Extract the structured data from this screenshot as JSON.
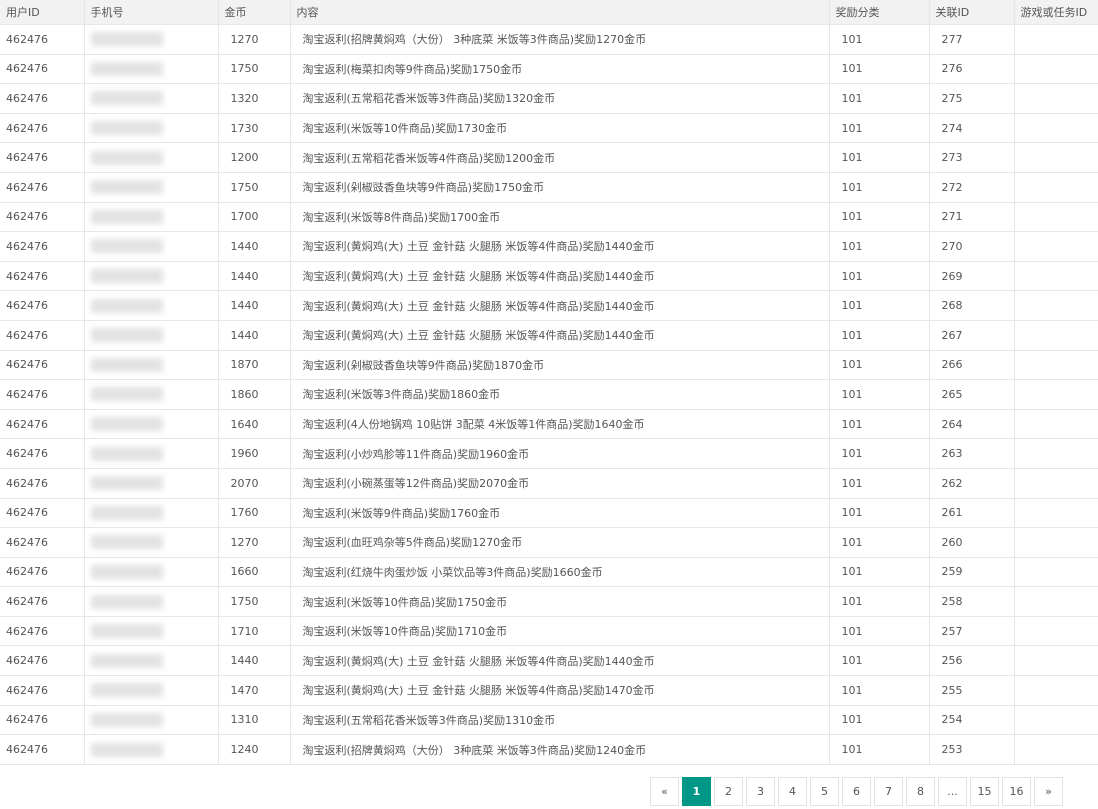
{
  "table": {
    "headers": [
      "用户ID",
      "手机号",
      "金币",
      "内容",
      "奖励分类",
      "关联ID",
      "游戏或任务ID"
    ],
    "rows": [
      {
        "uid": "462476",
        "coin": "1270",
        "content": "淘宝返利(招牌黄焖鸡（大份） 3种底菜 米饭等3件商品)奖励1270金币",
        "cat": "101",
        "rel": "277",
        "game": ""
      },
      {
        "uid": "462476",
        "coin": "1750",
        "content": "淘宝返利(梅菜扣肉等9件商品)奖励1750金币",
        "cat": "101",
        "rel": "276",
        "game": ""
      },
      {
        "uid": "462476",
        "coin": "1320",
        "content": "淘宝返利(五常稻花香米饭等3件商品)奖励1320金币",
        "cat": "101",
        "rel": "275",
        "game": ""
      },
      {
        "uid": "462476",
        "coin": "1730",
        "content": "淘宝返利(米饭等10件商品)奖励1730金币",
        "cat": "101",
        "rel": "274",
        "game": ""
      },
      {
        "uid": "462476",
        "coin": "1200",
        "content": "淘宝返利(五常稻花香米饭等4件商品)奖励1200金币",
        "cat": "101",
        "rel": "273",
        "game": ""
      },
      {
        "uid": "462476",
        "coin": "1750",
        "content": "淘宝返利(剁椒豉香鱼块等9件商品)奖励1750金币",
        "cat": "101",
        "rel": "272",
        "game": ""
      },
      {
        "uid": "462476",
        "coin": "1700",
        "content": "淘宝返利(米饭等8件商品)奖励1700金币",
        "cat": "101",
        "rel": "271",
        "game": ""
      },
      {
        "uid": "462476",
        "coin": "1440",
        "content": "淘宝返利(黄焖鸡(大) 土豆 金针菇 火腿肠 米饭等4件商品)奖励1440金币",
        "cat": "101",
        "rel": "270",
        "game": ""
      },
      {
        "uid": "462476",
        "coin": "1440",
        "content": "淘宝返利(黄焖鸡(大) 土豆 金针菇 火腿肠 米饭等4件商品)奖励1440金币",
        "cat": "101",
        "rel": "269",
        "game": ""
      },
      {
        "uid": "462476",
        "coin": "1440",
        "content": "淘宝返利(黄焖鸡(大) 土豆 金针菇 火腿肠 米饭等4件商品)奖励1440金币",
        "cat": "101",
        "rel": "268",
        "game": ""
      },
      {
        "uid": "462476",
        "coin": "1440",
        "content": "淘宝返利(黄焖鸡(大) 土豆 金针菇 火腿肠 米饭等4件商品)奖励1440金币",
        "cat": "101",
        "rel": "267",
        "game": ""
      },
      {
        "uid": "462476",
        "coin": "1870",
        "content": "淘宝返利(剁椒豉香鱼块等9件商品)奖励1870金币",
        "cat": "101",
        "rel": "266",
        "game": ""
      },
      {
        "uid": "462476",
        "coin": "1860",
        "content": "淘宝返利(米饭等3件商品)奖励1860金币",
        "cat": "101",
        "rel": "265",
        "game": ""
      },
      {
        "uid": "462476",
        "coin": "1640",
        "content": "淘宝返利(4人份地锅鸡 10贴饼 3配菜 4米饭等1件商品)奖励1640金币",
        "cat": "101",
        "rel": "264",
        "game": ""
      },
      {
        "uid": "462476",
        "coin": "1960",
        "content": "淘宝返利(小炒鸡胗等11件商品)奖励1960金币",
        "cat": "101",
        "rel": "263",
        "game": ""
      },
      {
        "uid": "462476",
        "coin": "2070",
        "content": "淘宝返利(小碗蒸蛋等12件商品)奖励2070金币",
        "cat": "101",
        "rel": "262",
        "game": ""
      },
      {
        "uid": "462476",
        "coin": "1760",
        "content": "淘宝返利(米饭等9件商品)奖励1760金币",
        "cat": "101",
        "rel": "261",
        "game": ""
      },
      {
        "uid": "462476",
        "coin": "1270",
        "content": "淘宝返利(血旺鸡杂等5件商品)奖励1270金币",
        "cat": "101",
        "rel": "260",
        "game": ""
      },
      {
        "uid": "462476",
        "coin": "1660",
        "content": "淘宝返利(红烧牛肉蛋炒饭 小菜饮品等3件商品)奖励1660金币",
        "cat": "101",
        "rel": "259",
        "game": ""
      },
      {
        "uid": "462476",
        "coin": "1750",
        "content": "淘宝返利(米饭等10件商品)奖励1750金币",
        "cat": "101",
        "rel": "258",
        "game": ""
      },
      {
        "uid": "462476",
        "coin": "1710",
        "content": "淘宝返利(米饭等10件商品)奖励1710金币",
        "cat": "101",
        "rel": "257",
        "game": ""
      },
      {
        "uid": "462476",
        "coin": "1440",
        "content": "淘宝返利(黄焖鸡(大) 土豆 金针菇 火腿肠 米饭等4件商品)奖励1440金币",
        "cat": "101",
        "rel": "256",
        "game": ""
      },
      {
        "uid": "462476",
        "coin": "1470",
        "content": "淘宝返利(黄焖鸡(大) 土豆 金针菇 火腿肠 米饭等4件商品)奖励1470金币",
        "cat": "101",
        "rel": "255",
        "game": ""
      },
      {
        "uid": "462476",
        "coin": "1310",
        "content": "淘宝返利(五常稻花香米饭等3件商品)奖励1310金币",
        "cat": "101",
        "rel": "254",
        "game": ""
      },
      {
        "uid": "462476",
        "coin": "1240",
        "content": "淘宝返利(招牌黄焖鸡（大份） 3种底菜 米饭等3件商品)奖励1240金币",
        "cat": "101",
        "rel": "253",
        "game": ""
      }
    ]
  },
  "pagination": {
    "prev": "«",
    "pages": [
      "1",
      "2",
      "3",
      "4",
      "5",
      "6",
      "7",
      "8",
      "...",
      "15",
      "16"
    ],
    "active": "1",
    "next": "»"
  },
  "colors": {
    "accent": "#009688",
    "header_bg": "#f2f2f2",
    "border": "#e6e6e6"
  }
}
